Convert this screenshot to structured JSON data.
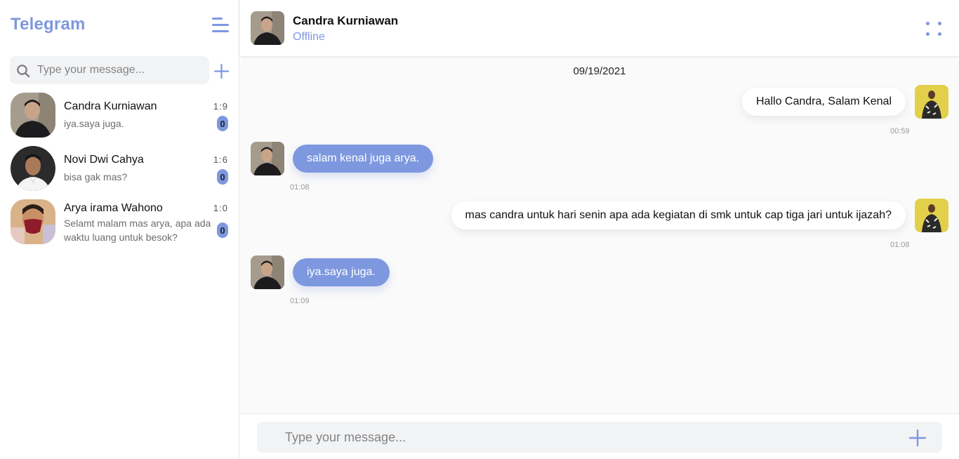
{
  "sidebar": {
    "brand": "Telegram",
    "search": {
      "placeholder": "Type your message..."
    },
    "contacts": [
      {
        "name": "Candra Kurniawan",
        "time": "1:9",
        "message": "iya.saya juga.",
        "unread": "0"
      },
      {
        "name": "Novi Dwi Cahya",
        "time": "1:6",
        "message": "bisa gak mas?",
        "unread": "0"
      },
      {
        "name": "Arya irama Wahono",
        "time": "1:0",
        "message": "Selamt malam mas arya, apa ada waktu luang untuk besok?",
        "unread": "0"
      }
    ]
  },
  "chat": {
    "header": {
      "name": "Candra Kurniawan",
      "status": "Offline"
    },
    "date": "09/19/2021",
    "messages": [
      {
        "direction": "out",
        "text": "Hallo Candra, Salam Kenal",
        "time": "00:59"
      },
      {
        "direction": "in",
        "text": "salam kenal juga arya.",
        "time": "01:08"
      },
      {
        "direction": "out",
        "text": "mas candra untuk hari senin apa ada kegiatan di smk untuk cap tiga jari untuk ijazah?",
        "time": "01:08"
      },
      {
        "direction": "in",
        "text": "iya.saya juga.",
        "time": "01:09"
      }
    ],
    "composer": {
      "placeholder": "Type your message..."
    }
  },
  "colors": {
    "accent": "#7e98df",
    "background": "#fafafa",
    "input_bg": "#f2f3f5"
  },
  "icons": [
    "menu-icon",
    "search-icon",
    "plus-icon",
    "more-dots-icon",
    "avatar-photo"
  ]
}
